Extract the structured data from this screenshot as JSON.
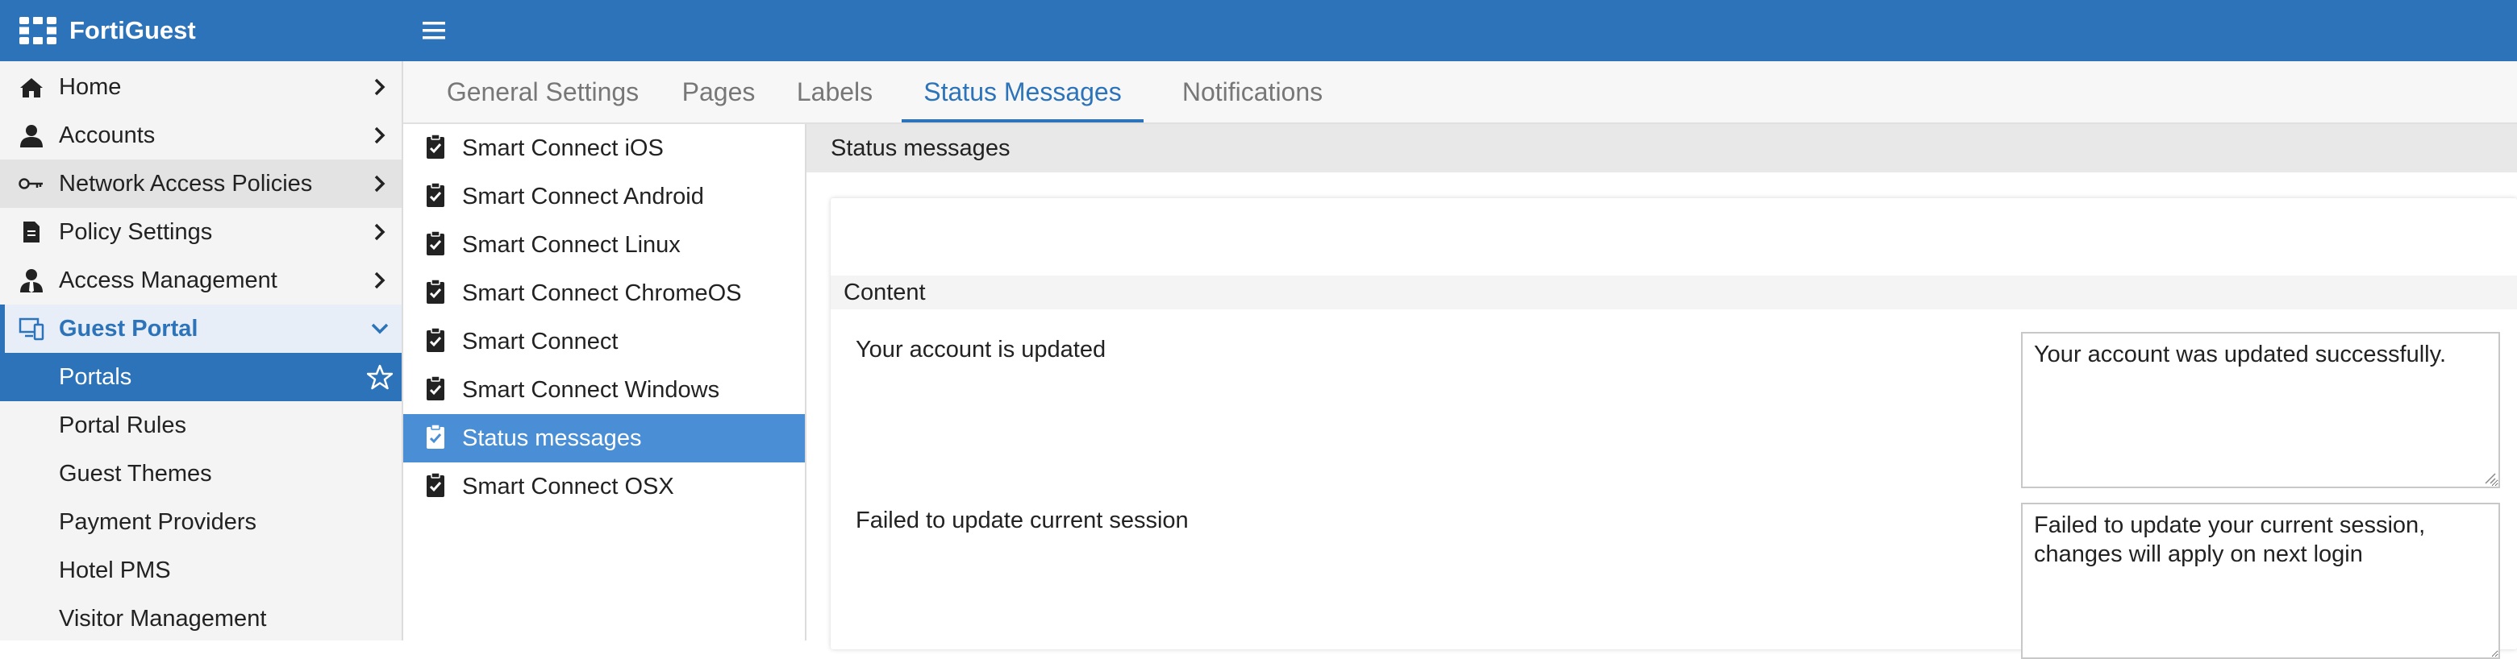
{
  "app": {
    "title": "FortiGuest"
  },
  "sidebar": {
    "items": [
      {
        "label": "Home",
        "icon": "home-icon"
      },
      {
        "label": "Accounts",
        "icon": "user-icon"
      },
      {
        "label": "Network Access Policies",
        "icon": "key-icon"
      },
      {
        "label": "Policy Settings",
        "icon": "document-icon"
      },
      {
        "label": "Access Management",
        "icon": "user-tie-icon"
      },
      {
        "label": "Guest Portal",
        "icon": "devices-icon"
      }
    ],
    "subitems": [
      {
        "label": "Portals"
      },
      {
        "label": "Portal Rules"
      },
      {
        "label": "Guest Themes"
      },
      {
        "label": "Payment Providers"
      },
      {
        "label": "Hotel PMS"
      },
      {
        "label": "Visitor Management"
      }
    ]
  },
  "tabs": [
    {
      "label": "General Settings"
    },
    {
      "label": "Pages"
    },
    {
      "label": "Labels"
    },
    {
      "label": "Status Messages"
    },
    {
      "label": "Notifications"
    }
  ],
  "pages_list": [
    {
      "label": "Smart Connect iOS"
    },
    {
      "label": "Smart Connect Android"
    },
    {
      "label": "Smart Connect Linux"
    },
    {
      "label": "Smart Connect ChromeOS"
    },
    {
      "label": "Smart Connect"
    },
    {
      "label": "Smart Connect Windows"
    },
    {
      "label": "Status messages"
    },
    {
      "label": "Smart Connect OSX"
    }
  ],
  "main": {
    "section_title": "Status messages",
    "content_title": "Content",
    "rows": [
      {
        "label": "Your account is updated",
        "value": "Your account was updated successfully."
      },
      {
        "label": "Failed to update current session",
        "value": "Failed to update your current session, changes will apply on next login"
      }
    ]
  },
  "colors": {
    "accent": "#2c73b9",
    "selected_list": "#4a8fd6"
  }
}
